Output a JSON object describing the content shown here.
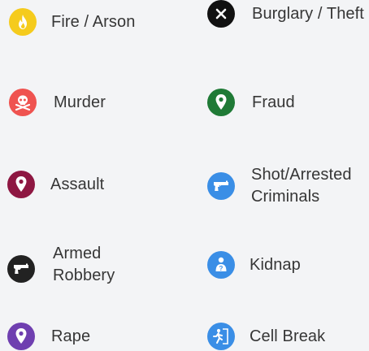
{
  "legend": {
    "items": [
      {
        "key": "fire",
        "label": "Fire / Arson",
        "icon": "flame-icon",
        "color": "#f5cb1d"
      },
      {
        "key": "burglary",
        "label": "Burglary / Theft",
        "icon": "close-icon",
        "color": "#111111"
      },
      {
        "key": "murder",
        "label": "Murder",
        "icon": "skull-icon",
        "color": "#ef5350"
      },
      {
        "key": "fraud",
        "label": "Fraud",
        "icon": "map-pin-icon",
        "color": "#1f7a36"
      },
      {
        "key": "assault",
        "label": "Assault",
        "icon": "map-pin-icon",
        "color": "#8e1742"
      },
      {
        "key": "shot",
        "label": "Shot/Arrested Criminals",
        "icon": "gun-icon",
        "color": "#3a8ee6"
      },
      {
        "key": "robbery",
        "label": "Armed Robbery",
        "icon": "gun-icon",
        "color": "#222222"
      },
      {
        "key": "kidnap",
        "label": "Kidnap",
        "icon": "person-alert-icon",
        "color": "#3a8ee6"
      },
      {
        "key": "rape",
        "label": "Rape",
        "icon": "map-pin-icon",
        "color": "#6f3fb0"
      },
      {
        "key": "cell_break",
        "label": "Cell Break",
        "icon": "running-exit-icon",
        "color": "#3a8ee6"
      }
    ]
  }
}
